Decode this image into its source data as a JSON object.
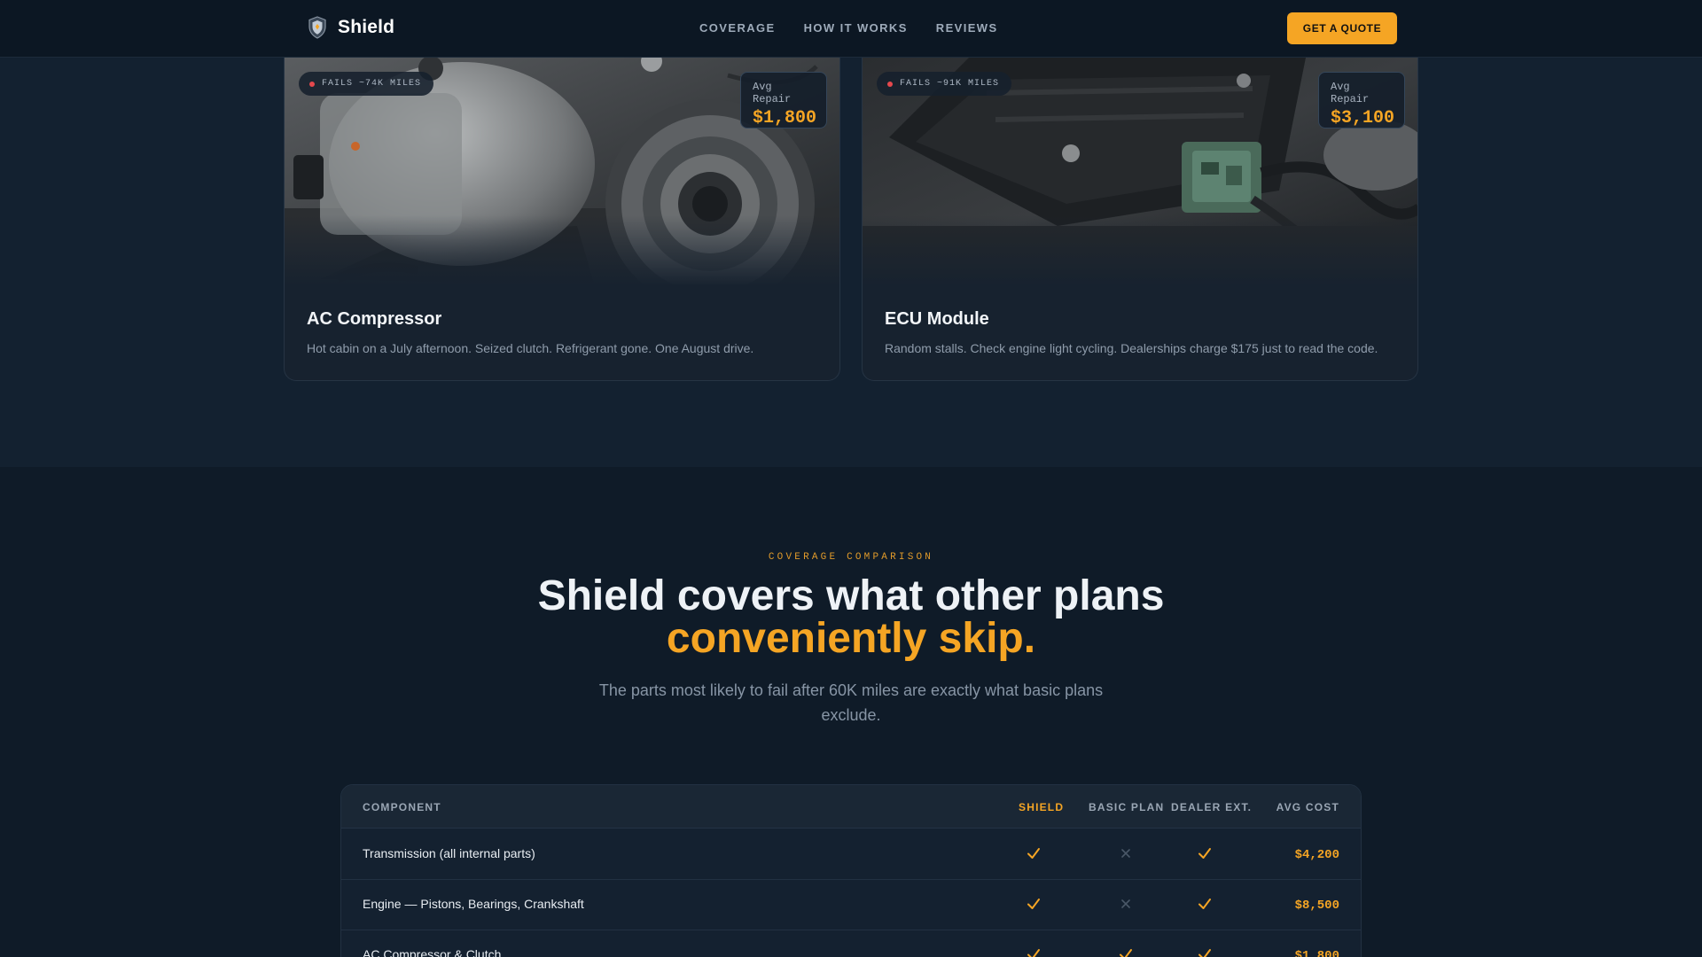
{
  "nav": {
    "brand": "Shield",
    "links": [
      "COVERAGE",
      "HOW IT WORKS",
      "REVIEWS"
    ],
    "cta": "GET A QUOTE"
  },
  "cards": [
    {
      "badge": "FAILS ~74K MILES",
      "repair_label": "Avg Repair",
      "repair_value": "$1,800",
      "title": "AC Compressor",
      "description": "Hot cabin on a July afternoon. Seized clutch. Refrigerant gone. One August drive."
    },
    {
      "badge": "FAILS ~91K MILES",
      "repair_label": "Avg Repair",
      "repair_value": "$3,100",
      "title": "ECU Module",
      "description": "Random stalls. Check engine light cycling. Dealerships charge $175 just to read the code."
    }
  ],
  "comparison": {
    "eyebrow": "COVERAGE COMPARISON",
    "headline": "Shield covers what other plans",
    "headline_accent": "conveniently skip.",
    "subtext": "The parts most likely to fail after 60K miles are exactly what basic plans exclude.",
    "columns": [
      "COMPONENT",
      "SHIELD",
      "BASIC PLAN",
      "DEALER EXT.",
      "AVG COST"
    ],
    "rows": [
      {
        "component": "Transmission (all internal parts)",
        "shield": true,
        "basic": false,
        "dealer": true,
        "cost": "$4,200"
      },
      {
        "component": "Engine — Pistons, Bearings, Crankshaft",
        "shield": true,
        "basic": false,
        "dealer": true,
        "cost": "$8,500"
      },
      {
        "component": "AC Compressor & Clutch",
        "shield": true,
        "basic": true,
        "dealer": true,
        "cost": "$1,800"
      }
    ]
  },
  "colors": {
    "accent": "#f5a524",
    "background": "#0f1b28",
    "card": "#17222f",
    "danger": "#e5484d"
  },
  "icons": [
    "shield-logo-icon",
    "check-icon",
    "cross-icon",
    "status-dot-icon"
  ]
}
